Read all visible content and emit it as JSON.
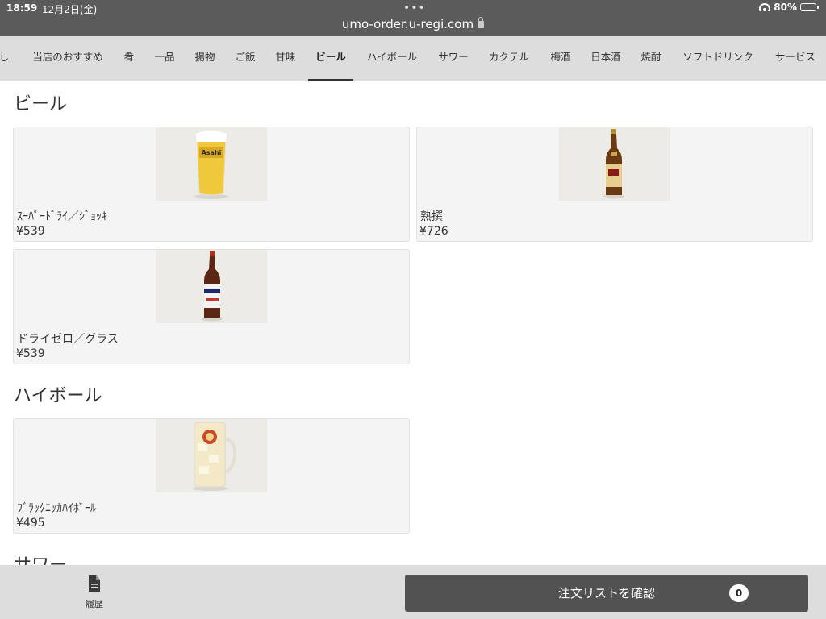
{
  "status": {
    "time": "18:59",
    "date": "12月2日(金)",
    "url": "umo-order.u-regi.com",
    "battery": "80%",
    "battery_level": 0.8
  },
  "tabs": [
    {
      "label": "し"
    },
    {
      "label": "当店のおすすめ"
    },
    {
      "label": "肴"
    },
    {
      "label": "一品"
    },
    {
      "label": "揚物"
    },
    {
      "label": "ご飯"
    },
    {
      "label": "甘味"
    },
    {
      "label": "ビール"
    },
    {
      "label": "ハイボール"
    },
    {
      "label": "サワー"
    },
    {
      "label": "カクテル"
    },
    {
      "label": "梅酒"
    },
    {
      "label": "日本酒"
    },
    {
      "label": "焼酎"
    },
    {
      "label": "ソフトドリンク"
    },
    {
      "label": "サービス"
    }
  ],
  "active_tab": "ビール",
  "sections": [
    {
      "title": "ビール",
      "items": [
        {
          "name": "ｽｰﾊﾟｰﾄﾞﾗｲ／ｼﾞｮｯｷ",
          "price": "¥539",
          "photo": "beer-mug-photo"
        },
        {
          "name": "熟撰",
          "price": "¥726",
          "photo": "beer-bottle-photo"
        },
        {
          "name": "ドライゼロ／グラス",
          "price": "¥539",
          "photo": "zero-bottle-photo"
        }
      ]
    },
    {
      "title": "ハイボール",
      "items": [
        {
          "name": "ﾌﾞﾗｯｸﾆｯｶﾊｲﾎﾞｰﾙ",
          "price": "¥495",
          "photo": "highball-mug-photo"
        }
      ]
    },
    {
      "title": "サワー",
      "items": []
    }
  ],
  "bottom": {
    "history_label": "履歴",
    "confirm_label": "注文リストを確認",
    "cart_count": "0"
  }
}
